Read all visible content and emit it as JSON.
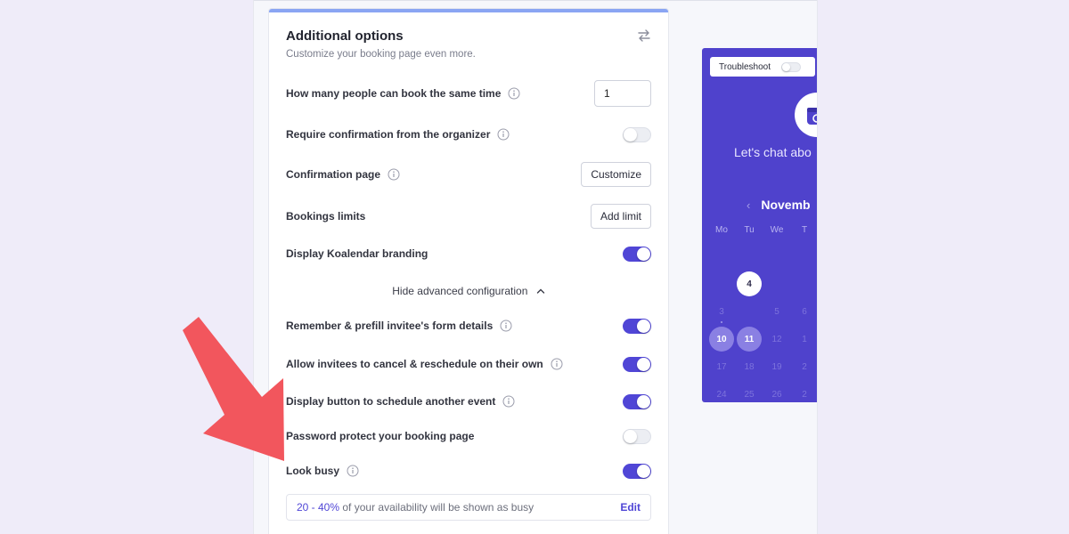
{
  "colors": {
    "accent": "#5046d6",
    "preview_bg": "#4f42cc",
    "arrow": "#f2565d",
    "page_bg": "#efecf9"
  },
  "card": {
    "title": "Additional options",
    "subtitle": "Customize your booking page even more.",
    "swap_icon": "swap-arrows-icon"
  },
  "options": {
    "seats": {
      "label": "How many people can book the same time",
      "value": "1"
    },
    "require_confirmation": {
      "label": "Require confirmation from the organizer",
      "enabled": false
    },
    "confirmation_page": {
      "label": "Confirmation page",
      "button": "Customize"
    },
    "booking_limits": {
      "label": "Bookings limits",
      "button": "Add limit"
    },
    "branding": {
      "label": "Display Koalendar branding",
      "enabled": true
    },
    "advanced_toggle": "Hide advanced configuration",
    "prefill": {
      "label": "Remember & prefill invitee's form details",
      "enabled": true
    },
    "cancel_reschedule": {
      "label": "Allow invitees to cancel & reschedule on their own",
      "enabled": true
    },
    "schedule_another": {
      "label": "Display button to schedule another event",
      "enabled": true
    },
    "password_protect": {
      "label": "Password protect your booking page",
      "enabled": false
    },
    "look_busy": {
      "label": "Look busy",
      "enabled": true
    }
  },
  "busy_note": {
    "range": "20 - 40%",
    "text": "of your availability will be shown as busy",
    "edit": "Edit"
  },
  "preview": {
    "troubleshoot": "Troubleshoot",
    "chat_title": "Let's chat abo",
    "prev_icon": "chevron-left-icon",
    "month": "Novemb",
    "weekdays": [
      "Mo",
      "Tu",
      "We",
      "T"
    ],
    "weeks": [
      [
        "",
        "4",
        "",
        ""
      ],
      [
        "3",
        "",
        "5",
        "6"
      ],
      [
        "10",
        "11",
        "12",
        "1"
      ],
      [
        "17",
        "18",
        "19",
        "2"
      ],
      [
        "24",
        "25",
        "26",
        "2"
      ]
    ],
    "today": "4",
    "available_days": [
      "10",
      "11"
    ]
  }
}
